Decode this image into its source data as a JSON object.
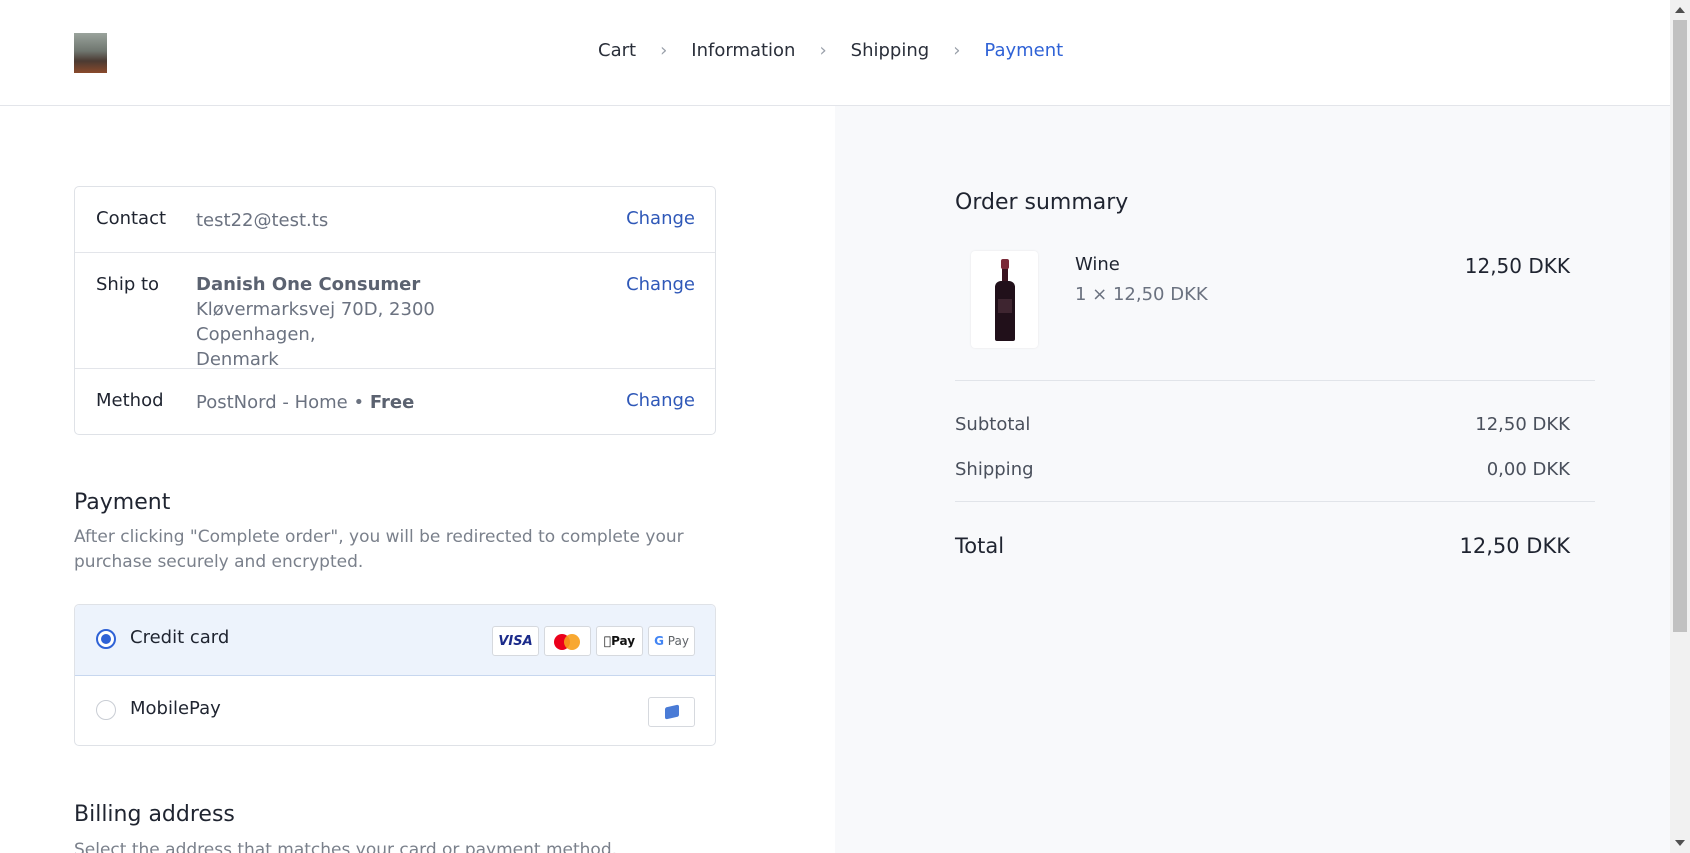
{
  "breadcrumb": {
    "steps": [
      {
        "label": "Cart"
      },
      {
        "label": "Information"
      },
      {
        "label": "Shipping"
      },
      {
        "label": "Payment"
      }
    ],
    "active_index": 3
  },
  "review": {
    "contact": {
      "label": "Contact",
      "value": "test22@test.ts",
      "change": "Change"
    },
    "ship_to": {
      "label": "Ship to",
      "name": "Danish One Consumer",
      "address_line1": "Kløvermarksvej 70D, 2300 Copenhagen,",
      "address_line2": "Denmark",
      "change": "Change"
    },
    "method": {
      "label": "Method",
      "value": "PostNord - Home",
      "separator": "•",
      "price": "Free",
      "change": "Change"
    }
  },
  "payment": {
    "title": "Payment",
    "description": "After clicking \"Complete order\", you will be redirected to complete your purchase securely and encrypted.",
    "options": [
      {
        "label": "Credit card",
        "selected": true,
        "icons": [
          "visa-icon",
          "mastercard-icon",
          "apple-pay-icon",
          "google-pay-icon"
        ]
      },
      {
        "label": "MobilePay",
        "selected": false,
        "icons": [
          "mobilepay-icon"
        ]
      }
    ],
    "card_texts": {
      "visa": "VISA",
      "apple_pay": "Pay",
      "google_pay_g": "G",
      "google_pay": "Pay"
    }
  },
  "billing": {
    "title": "Billing address",
    "description": "Select the address that matches your card or payment method."
  },
  "summary": {
    "title": "Order summary",
    "item": {
      "name": "Wine",
      "qty_line": "1 × 12,50 DKK",
      "price": "12,50 DKK"
    },
    "subtotal_label": "Subtotal",
    "subtotal_value": "12,50 DKK",
    "shipping_label": "Shipping",
    "shipping_value": "0,00 DKK",
    "total_label": "Total",
    "total_value": "12,50 DKK"
  },
  "colors": {
    "accent": "#2f62d6",
    "link": "#2f58b8",
    "selected_bg": "#edf3fc",
    "summary_bg": "#f8f9fb"
  }
}
